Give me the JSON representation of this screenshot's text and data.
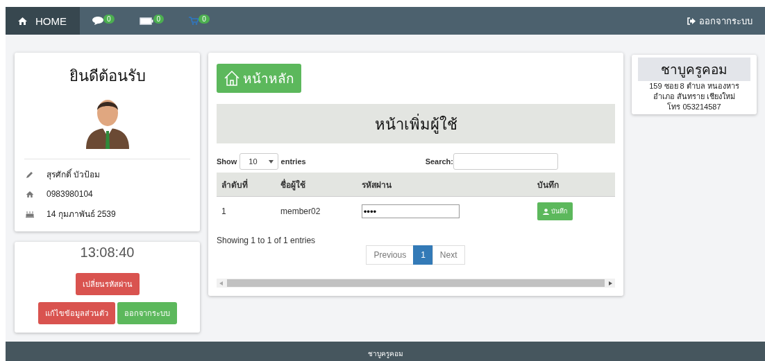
{
  "navbar": {
    "items": [
      {
        "kind": "home",
        "label": "HOME",
        "selected": true
      },
      {
        "kind": "chat",
        "badge": "0",
        "selected": false
      },
      {
        "kind": "battery",
        "badge": "0",
        "selected": false
      },
      {
        "kind": "cart",
        "badge": "0",
        "selected": false
      }
    ],
    "logout": "ออกจากระบบ"
  },
  "profile": {
    "title": "ยินดีต้อนรับ",
    "details": [
      {
        "kind": "pencil",
        "text": "สุรศักดิ์ บัวป้อม"
      },
      {
        "kind": "home",
        "text": "0983980104"
      },
      {
        "kind": "cake",
        "text": "14 กุมภาพันธ์ 2539"
      }
    ]
  },
  "clock": {
    "time": "13:08:40",
    "buttons": [
      {
        "label": "เปลี่ยนรหัสผ่าน",
        "kind": "danger"
      },
      {
        "label": "แก้ไขข้อมูลส่วนตัว",
        "kind": "danger"
      },
      {
        "label": "ออกจากระบบ",
        "kind": "success"
      }
    ]
  },
  "main": {
    "home_button": "หน้าหลัก",
    "heading": "หน้าเพิ่มผู้ใช้",
    "show_label": "Show",
    "page_size": "10",
    "entries_label": "entries",
    "search_label": "Search:",
    "columns": [
      "ลำดับที่",
      "ชื่อผู้ใช้",
      "รหัสผ่าน",
      "บันทึก"
    ],
    "rows": [
      {
        "index": "1",
        "username": "member02",
        "password": "••••",
        "save": "บันทึก"
      }
    ],
    "info": "Showing 1 to 1 of 1 entries",
    "pagination": [
      {
        "label": "Previous",
        "selected": false
      },
      {
        "label": "1",
        "selected": true
      },
      {
        "label": "Next",
        "selected": false
      }
    ]
  },
  "shop": {
    "name": "ชาบูครูคอม",
    "address": [
      "159 ซอย 8 ตำบล หนองหาร",
      "อำเภอ สันทราย เชียงใหม่",
      "โทร 053214587"
    ]
  },
  "footer": {
    "text": "ชาบูครูคอม"
  }
}
